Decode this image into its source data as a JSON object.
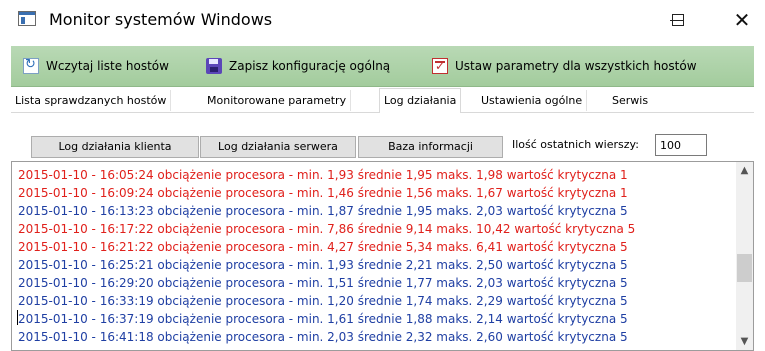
{
  "window": {
    "title": "Monitor systemów Windows",
    "icon": "app-window-icon",
    "controls": {
      "minimize": "minimize-icon",
      "maximize": "maximize-icon",
      "close": "✕"
    }
  },
  "toolbar": {
    "load_hosts": "Wczytaj liste hostów",
    "save_config": "Zapisz konfigurację ogólną",
    "set_params": "Ustaw parametry dla wszystkich hostów"
  },
  "tabs": [
    {
      "label": "Lista sprawdzanych hostów"
    },
    {
      "label": "Monitorowane parametry"
    },
    {
      "label": "Log działania",
      "active": true
    },
    {
      "label": "Ustawienia ogólne"
    },
    {
      "label": "Serwis"
    }
  ],
  "panel": {
    "client_log_button": "Log działania klienta",
    "server_log_button": "Log działania serwera",
    "info_db_button": "Baza informacji",
    "count_label": "Ilość ostatnich wierszy:",
    "count_value": "100"
  },
  "colors": {
    "critical": "#e0201b",
    "normal": "#1f3fa3",
    "toolbar_bg": "#a9cfa3"
  },
  "log": [
    {
      "text": "2015-01-10 - 16:05:24 obciążenie procesora - min. 1,93 średnie 1,95 maks. 1,98 wartość krytyczna 1",
      "critical": true
    },
    {
      "text": "2015-01-10 - 16:09:24 obciążenie procesora - min. 1,46 średnie 1,56 maks. 1,67 wartość krytyczna 1",
      "critical": true
    },
    {
      "text": "2015-01-10 - 16:13:23 obciążenie procesora - min. 1,87 średnie 1,95 maks. 2,03 wartość krytyczna 5",
      "critical": false
    },
    {
      "text": "2015-01-10 - 16:17:22 obciążenie procesora - min. 7,86 średnie 9,14 maks. 10,42 wartość krytyczna 5",
      "critical": true
    },
    {
      "text": "2015-01-10 - 16:21:22 obciążenie procesora - min. 4,27 średnie 5,34 maks. 6,41 wartość krytyczna 5",
      "critical": true
    },
    {
      "text": "2015-01-10 - 16:25:21 obciążenie procesora - min. 1,93 średnie 2,21 maks. 2,50 wartość krytyczna 5",
      "critical": false
    },
    {
      "text": "2015-01-10 - 16:29:20 obciążenie procesora - min. 1,51 średnie 1,77 maks. 2,03 wartość krytyczna 5",
      "critical": false
    },
    {
      "text": "2015-01-10 - 16:33:19 obciążenie procesora - min. 1,20 średnie 1,74 maks. 2,29 wartość krytyczna 5",
      "critical": false
    },
    {
      "text": "2015-01-10 - 16:37:19 obciążenie procesora - min. 1,61 średnie 1,88 maks. 2,14 wartość krytyczna 5",
      "critical": false
    },
    {
      "text": "2015-01-10 - 16:41:18 obciążenie procesora - min. 2,03 średnie 2,32 maks. 2,60 wartość krytyczna 5",
      "critical": false
    }
  ]
}
